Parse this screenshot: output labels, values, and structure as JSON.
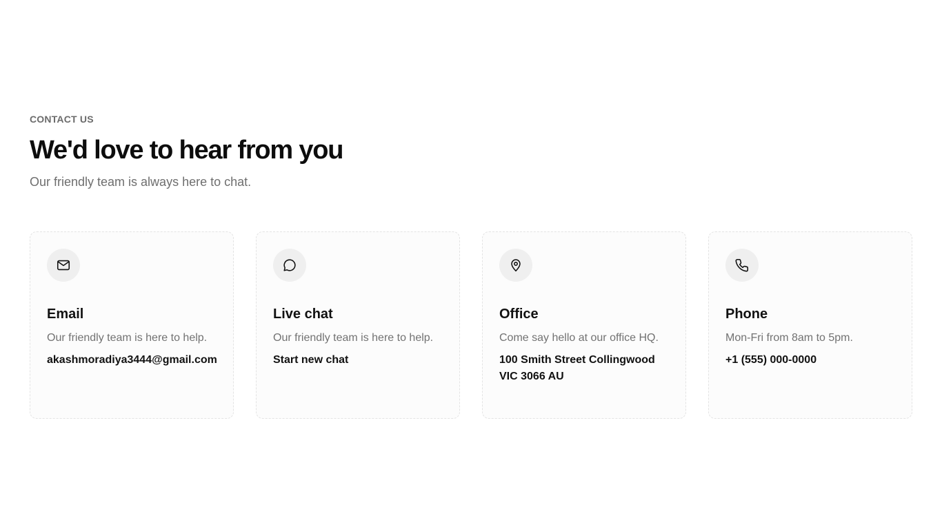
{
  "header": {
    "eyebrow": "CONTACT US",
    "title": "We'd love to hear from you",
    "subtitle": "Our friendly team is always here to chat."
  },
  "cards": [
    {
      "icon": "mail-icon",
      "title": "Email",
      "description": "Our friendly team is here to help.",
      "link": "akashmoradiya3444@gmail.com"
    },
    {
      "icon": "chat-bubble-icon",
      "title": "Live chat",
      "description": "Our friendly team is here to help.",
      "link": "Start new chat"
    },
    {
      "icon": "map-pin-icon",
      "title": "Office",
      "description": "Come say hello at our office HQ.",
      "link": "100 Smith Street Collingwood\nVIC 3066 AU"
    },
    {
      "icon": "phone-icon",
      "title": "Phone",
      "description": "Mon-Fri from 8am to 5pm.",
      "link": "+1 (555) 000-0000"
    }
  ]
}
